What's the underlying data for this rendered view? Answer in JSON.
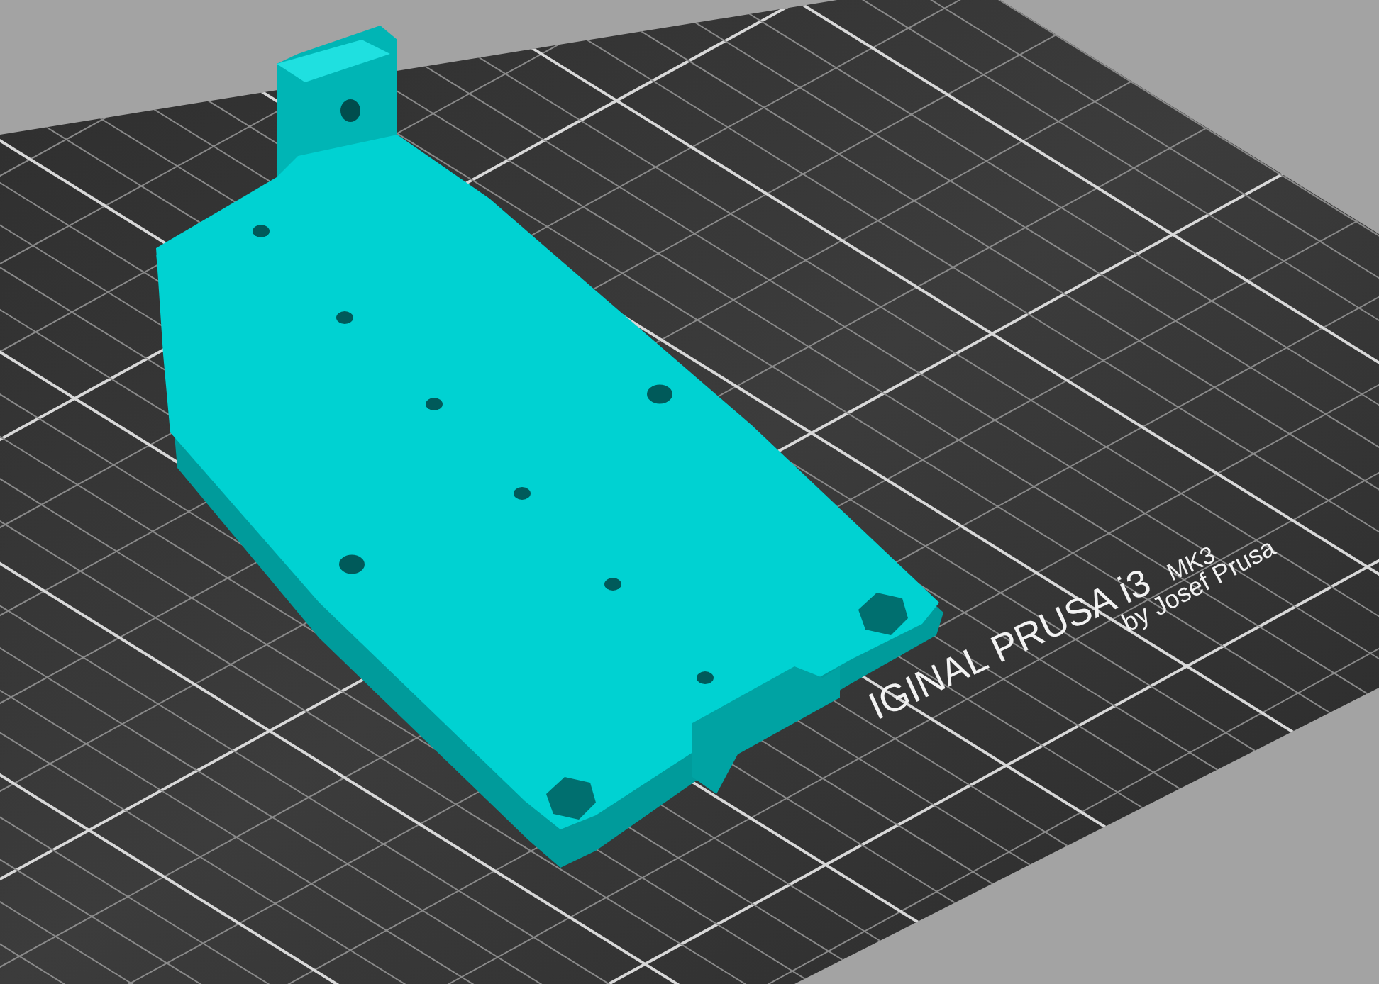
{
  "bed_label": {
    "brand": "IGINAL PRUSA i3",
    "model": "MK3",
    "credit": "by Josef Prusa"
  }
}
